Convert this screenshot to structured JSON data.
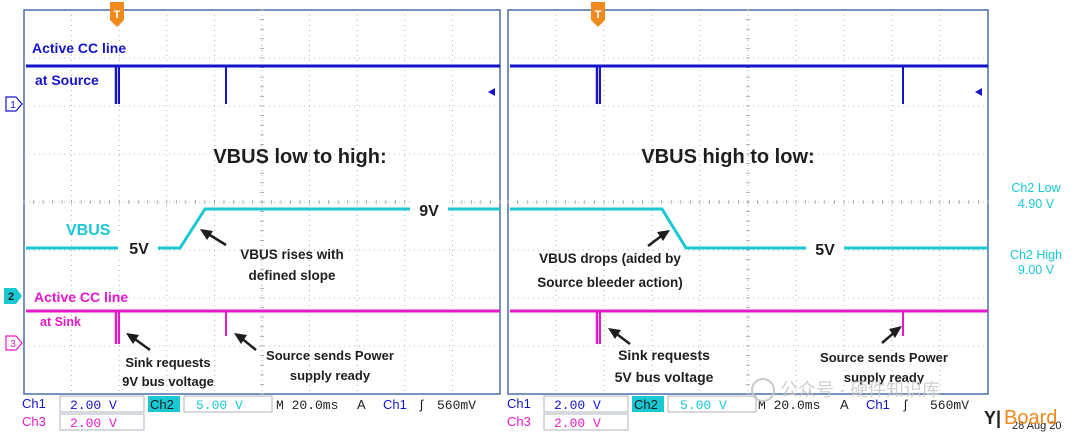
{
  "colors": {
    "ch1": "#1414c8",
    "ch2": "#19c8d2",
    "ch3": "#e619c8",
    "grid": "#9aa3ad",
    "frame": "#4a6fa5",
    "trigger": "#f08a1c",
    "annotation": "#1e1e1e",
    "watermark": "#c8c8c8",
    "logo_accent": "#f08a1c"
  },
  "left_panel": {
    "title": "VBUS low to high:",
    "ch1_label_1": "Active CC line",
    "ch1_label_2": "at Source",
    "ch2_label": "VBUS",
    "ch2_low": "5V",
    "ch2_high": "9V",
    "ch3_label_1": "Active CC line",
    "ch3_label_2": "at Sink",
    "note_rise_1": "VBUS rises with",
    "note_rise_2": "defined slope",
    "note_sink_1": "Sink requests",
    "note_sink_2": "9V bus voltage",
    "note_source_1": "Source sends Power",
    "note_source_2": "supply ready"
  },
  "right_panel": {
    "title": "VBUS high to low:",
    "ch2_low": "5V",
    "note_drop_1": "VBUS drops (aided by",
    "note_drop_2": "Source bleeder action)",
    "note_sink_1": "Sink requests",
    "note_sink_2": "5V bus voltage",
    "note_source_1": "Source sends Power",
    "note_source_2": "supply ready"
  },
  "markers": {
    "trigger": "T",
    "ch1": "1",
    "ch2": "2",
    "ch3": "3"
  },
  "cursor_readouts": {
    "low_label": "Ch2 Low",
    "low_value": "4.90 V",
    "high_label": "Ch2 High",
    "high_value": "9.00 V"
  },
  "status_left": {
    "ch1": "Ch1",
    "ch1_scale": "2.00 V",
    "ch2": "Ch2",
    "ch2_scale": "5.00 V",
    "timebase": "M 20.0ms",
    "trig_mode": "A",
    "trig_src": "Ch1",
    "trig_level": "560mV",
    "ch3": "Ch3",
    "ch3_scale": "2.00 V"
  },
  "status_right": {
    "ch1": "Ch1",
    "ch1_scale": "2.00 V",
    "ch2": "Ch2",
    "ch2_scale": "5.00 V",
    "timebase": "M 20.0ms",
    "trig_mode": "A",
    "trig_src": "Ch1",
    "trig_level": "560mV",
    "ch3": "Ch3",
    "ch3_scale": "2.00 V",
    "date": "28 Aug 20"
  },
  "watermark": {
    "text": "公众号 · 硬件知识库",
    "logo": "Board"
  }
}
